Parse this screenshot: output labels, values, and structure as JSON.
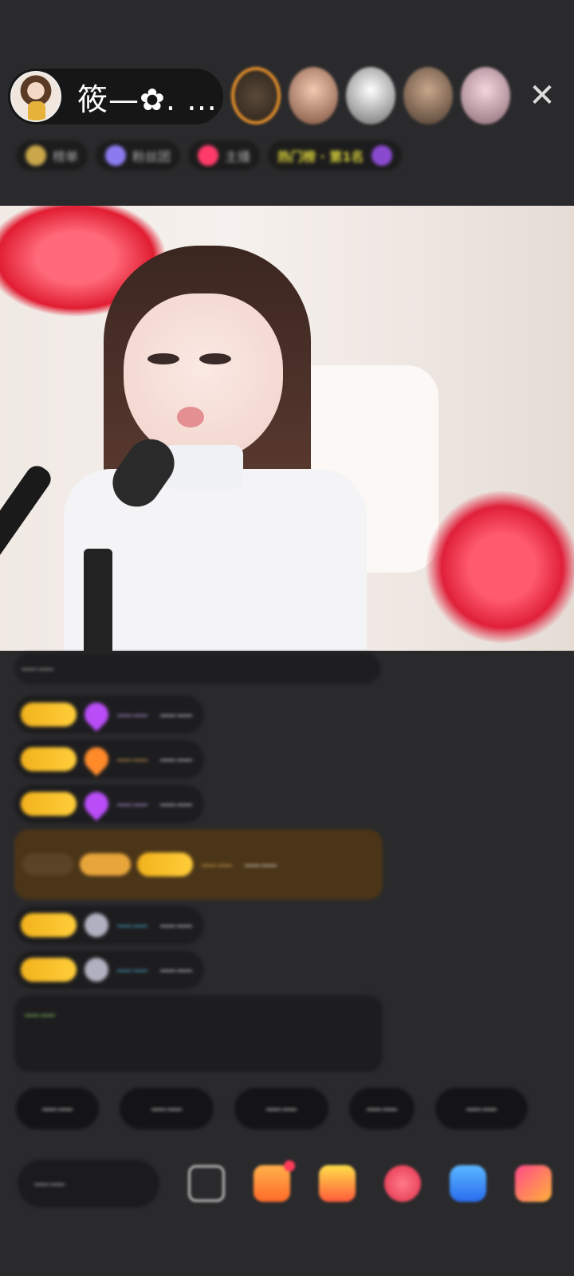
{
  "header": {
    "host_name": "筱—✿. …",
    "close_icon": "✕",
    "viewers": [
      "viewer-1",
      "viewer-2",
      "viewer-3",
      "viewer-4",
      "viewer-5"
    ]
  },
  "info_row": {
    "chips": [
      "榜单",
      "粉丝团",
      "主播",
      "热门榜 · 第1名"
    ]
  },
  "chat": {
    "messages": [
      {
        "nick": "",
        "text": "——"
      },
      {
        "nick": "——",
        "text": "——"
      },
      {
        "nick": "——",
        "text": "——"
      },
      {
        "nick": "——",
        "text": "——"
      },
      {
        "nick": "——",
        "text": "——"
      },
      {
        "nick": "——",
        "text": "——"
      },
      {
        "nick": "——",
        "text": "——"
      }
    ],
    "system_text": "——"
  },
  "quick_replies": [
    "——",
    "——",
    "——",
    "——",
    "——"
  ],
  "bottom": {
    "comment_placeholder": "——"
  },
  "colors": {
    "background": "#2a2a2c",
    "badge": "#f2b21c",
    "gift_row": "#4b3518",
    "system_text": "#8ccf6a"
  },
  "icons": [
    "emoji-icon",
    "shop-icon",
    "gift-icon",
    "heart-icon",
    "game-icon",
    "more-icon"
  ]
}
